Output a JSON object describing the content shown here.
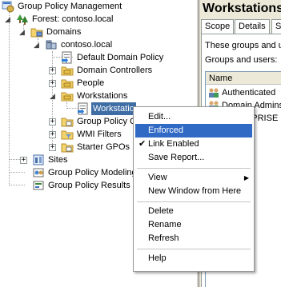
{
  "tree": {
    "root": "Group Policy Management",
    "forest": "Forest: contoso.local",
    "domains": "Domains",
    "domain": "contoso.local",
    "default_policy": "Default Domain Policy",
    "domain_controllers": "Domain Controllers",
    "people": "People",
    "workstations": "Workstations",
    "selected_link": "Workstations",
    "group_policy_objects": "Group Policy C",
    "wmi_filters": "WMI Filters",
    "starter_gpos": "Starter GPOs",
    "sites": "Sites",
    "modeling": "Group Policy Modeling",
    "results": "Group Policy Results"
  },
  "right": {
    "title": "Workstations",
    "tabs": [
      "Scope",
      "Details",
      "S"
    ],
    "text1": "These groups and u",
    "text2": "Groups and users:",
    "list_header": "Name",
    "rows": [
      "Authenticated",
      "Domain Admins",
      "ENTERPRISE"
    ]
  },
  "menu": {
    "edit": "Edit...",
    "enforced": "Enforced",
    "link_enabled": "Link Enabled",
    "save_report": "Save Report...",
    "view": "View",
    "new_window": "New Window from Here",
    "delete": "Delete",
    "rename": "Rename",
    "refresh": "Refresh",
    "help": "Help"
  },
  "colors": {
    "selection": "#3f6ea5",
    "menu_highlight": "#316ac5",
    "folder": "#f3d36b"
  }
}
